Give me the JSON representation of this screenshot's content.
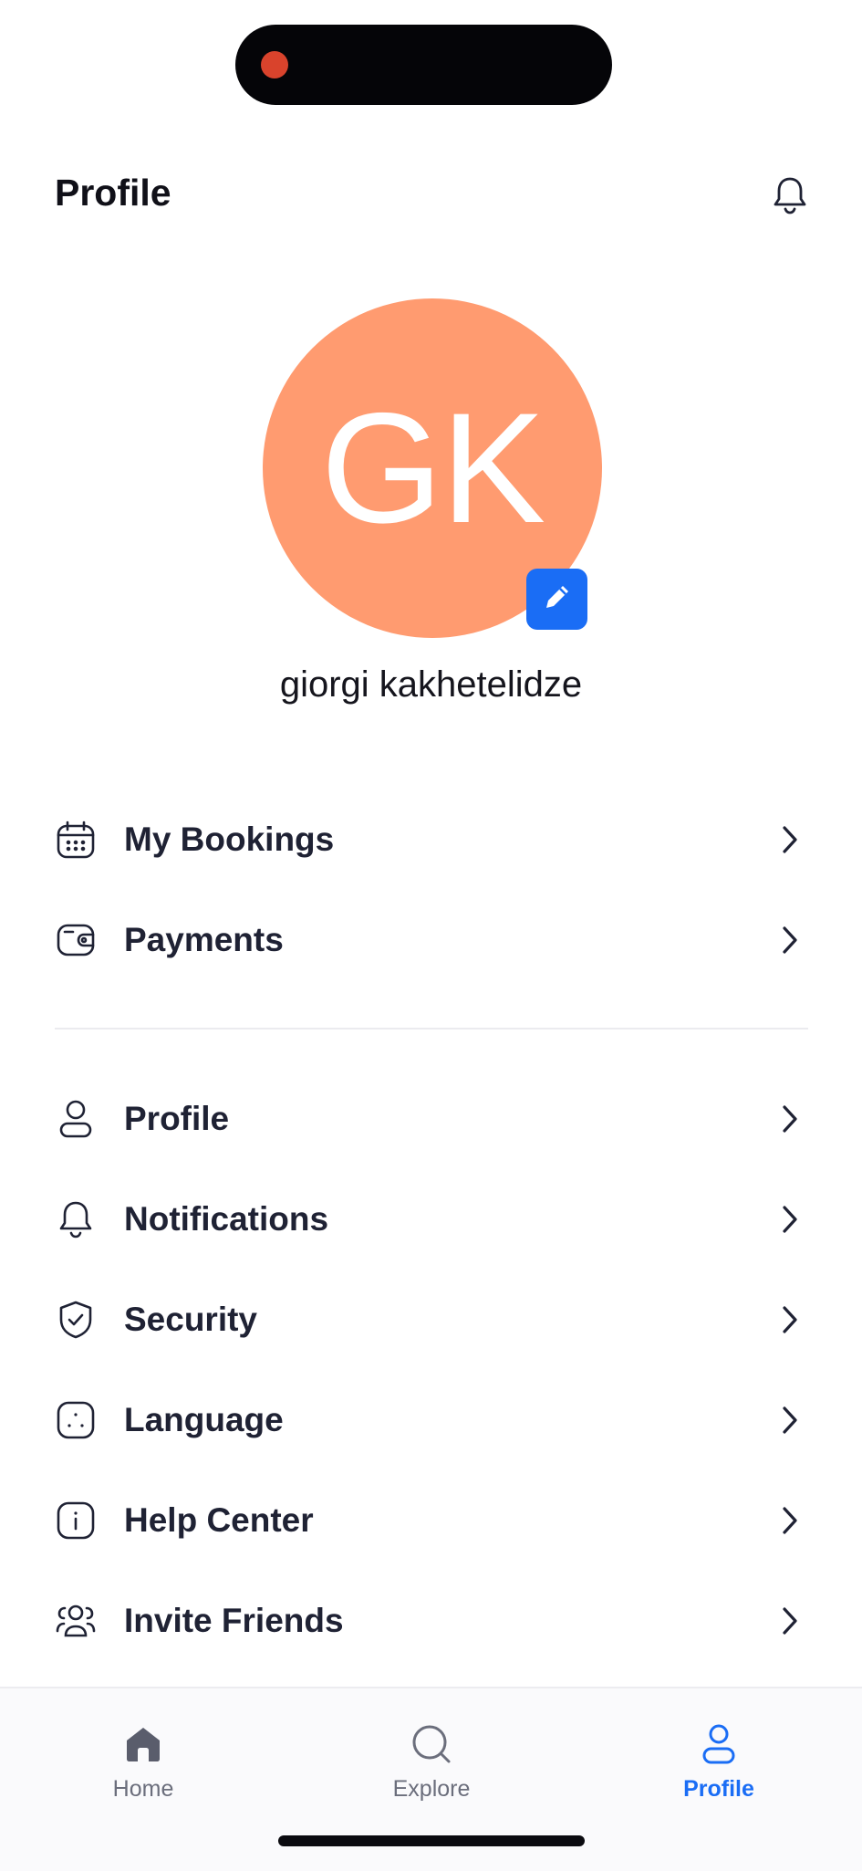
{
  "header": {
    "title": "Profile",
    "bell_icon": "bell-icon"
  },
  "profile": {
    "initials": "GK",
    "name": "giorgi kakhetelidze",
    "avatar_color": "#ff9b70",
    "edit_icon": "pencil-icon"
  },
  "menu_group_1": [
    {
      "label": "My Bookings",
      "icon": "calendar-icon"
    },
    {
      "label": "Payments",
      "icon": "wallet-icon"
    }
  ],
  "menu_group_2": [
    {
      "label": "Profile",
      "icon": "user-icon"
    },
    {
      "label": "Notifications",
      "icon": "bell-icon"
    },
    {
      "label": "Security",
      "icon": "shield-icon"
    },
    {
      "label": "Language",
      "icon": "language-icon"
    },
    {
      "label": "Help Center",
      "icon": "info-icon"
    },
    {
      "label": "Invite Friends",
      "icon": "people-icon"
    }
  ],
  "tabs": [
    {
      "label": "Home",
      "icon": "home-icon",
      "active": false
    },
    {
      "label": "Explore",
      "icon": "search-icon",
      "active": false
    },
    {
      "label": "Profile",
      "icon": "user-icon",
      "active": true
    }
  ],
  "colors": {
    "accent": "#1a6df5",
    "text": "#1f2234",
    "inactive_tab": "#6b6e7c"
  }
}
